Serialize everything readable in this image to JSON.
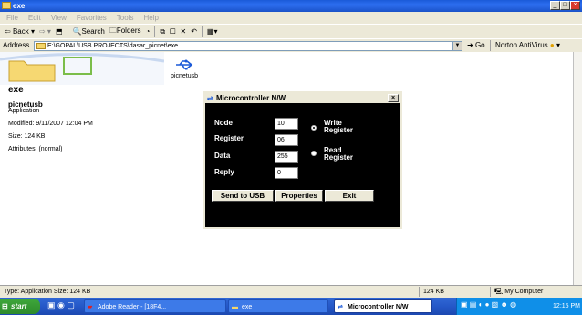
{
  "window": {
    "title": "exe"
  },
  "menu": [
    "File",
    "Edit",
    "View",
    "Favorites",
    "Tools",
    "Help"
  ],
  "toolbar": {
    "back": "Back",
    "search": "Search",
    "folders": "Folders"
  },
  "address": {
    "label": "Address",
    "path": "E:\\GOPAL\\USB PROJECTS\\dasar_picnet\\exe",
    "go": "Go",
    "norton": "Norton AntiVirus"
  },
  "details": {
    "folder_name": "exe",
    "file_name": "picnetusb",
    "file_type": "Application",
    "modified": "Modified: 9/11/2007 12:04 PM",
    "size": "Size: 124 KB",
    "attributes": "Attributes: (normal)"
  },
  "files": [
    {
      "name": "picnetusb"
    }
  ],
  "dialog": {
    "title": "Microcontroller N/W",
    "fields": [
      {
        "label": "Node",
        "value": "10"
      },
      {
        "label": "Register",
        "value": "06"
      },
      {
        "label": "Data",
        "value": "255"
      },
      {
        "label": "Reply",
        "value": "0"
      }
    ],
    "radio_write": "Write Register",
    "radio_read": "Read Register",
    "selected_mode": "Write Register",
    "buttons": {
      "send": "Send to USB",
      "properties": "Properties",
      "exit": "Exit"
    }
  },
  "status": {
    "type": "Type: Application Size: 124 KB",
    "size": "124 KB",
    "zone": "My Computer"
  },
  "taskbar": {
    "start": "start",
    "items": [
      "Adobe Reader - [18F4...",
      "exe",
      "Microcontroller N/W"
    ],
    "clock": "12:15 PM"
  }
}
